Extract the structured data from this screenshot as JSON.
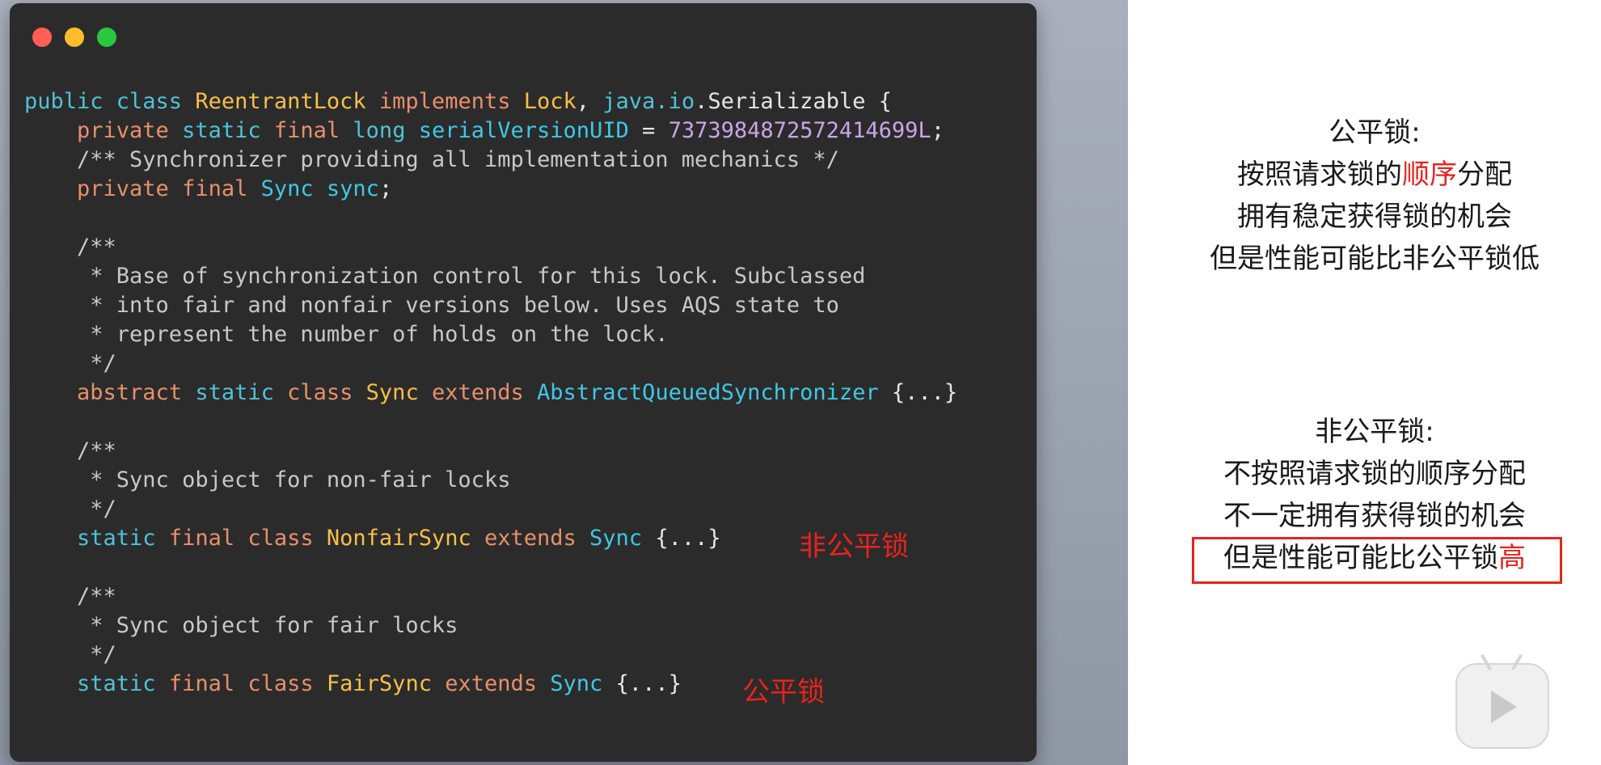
{
  "code": {
    "lines": [
      [
        {
          "t": "public class ",
          "c": "kw2"
        },
        {
          "t": "ReentrantLock",
          "c": "cls"
        },
        {
          "t": " implements ",
          "c": "kw"
        },
        {
          "t": "Lock",
          "c": "cls"
        },
        {
          "t": ", ",
          "c": "punc"
        },
        {
          "t": "java.io",
          "c": "pkg"
        },
        {
          "t": ".Serializable {",
          "c": "punc"
        }
      ],
      [
        {
          "t": "    private ",
          "c": "kw"
        },
        {
          "t": "static ",
          "c": "kw2"
        },
        {
          "t": "final ",
          "c": "kw"
        },
        {
          "t": "long ",
          "c": "kw2"
        },
        {
          "t": "serialVersionUID",
          "c": "type"
        },
        {
          "t": " = ",
          "c": "punc"
        },
        {
          "t": "7373984872572414699L",
          "c": "num"
        },
        {
          "t": ";",
          "c": "punc"
        }
      ],
      [
        {
          "t": "    /** Synchronizer providing all implementation mechanics */",
          "c": "cm"
        }
      ],
      [
        {
          "t": "    private ",
          "c": "kw"
        },
        {
          "t": "final ",
          "c": "kw"
        },
        {
          "t": "Sync ",
          "c": "type"
        },
        {
          "t": "sync",
          "c": "type"
        },
        {
          "t": ";",
          "c": "punc"
        }
      ],
      [
        {
          "t": "",
          "c": "punc"
        }
      ],
      [
        {
          "t": "    /**",
          "c": "cm"
        }
      ],
      [
        {
          "t": "     * Base of synchronization control for this lock. Subclassed",
          "c": "cm"
        }
      ],
      [
        {
          "t": "     * into fair and nonfair versions below. Uses AQS state to",
          "c": "cm"
        }
      ],
      [
        {
          "t": "     * represent the number of holds on the lock.",
          "c": "cm"
        }
      ],
      [
        {
          "t": "     */",
          "c": "cm"
        }
      ],
      [
        {
          "t": "    abstract ",
          "c": "kw"
        },
        {
          "t": "static ",
          "c": "kw2"
        },
        {
          "t": "class ",
          "c": "kw"
        },
        {
          "t": "Sync",
          "c": "cls"
        },
        {
          "t": " extends ",
          "c": "kw"
        },
        {
          "t": "AbstractQueuedSynchronizer",
          "c": "type"
        },
        {
          "t": " {...}",
          "c": "punc"
        }
      ],
      [
        {
          "t": "",
          "c": "punc"
        }
      ],
      [
        {
          "t": "    /**",
          "c": "cm"
        }
      ],
      [
        {
          "t": "     * Sync object for non-fair locks",
          "c": "cm"
        }
      ],
      [
        {
          "t": "     */",
          "c": "cm"
        }
      ],
      [
        {
          "t": "    static ",
          "c": "kw2"
        },
        {
          "t": "final ",
          "c": "kw"
        },
        {
          "t": "class ",
          "c": "kw"
        },
        {
          "t": "NonfairSync",
          "c": "cls"
        },
        {
          "t": " extends ",
          "c": "kw"
        },
        {
          "t": "Sync",
          "c": "type"
        },
        {
          "t": " {...}",
          "c": "punc"
        }
      ],
      [
        {
          "t": "",
          "c": "punc"
        }
      ],
      [
        {
          "t": "    /**",
          "c": "cm"
        }
      ],
      [
        {
          "t": "     * Sync object for fair locks",
          "c": "cm"
        }
      ],
      [
        {
          "t": "     */",
          "c": "cm"
        }
      ],
      [
        {
          "t": "    static ",
          "c": "kw2"
        },
        {
          "t": "final ",
          "c": "kw"
        },
        {
          "t": "class ",
          "c": "kw"
        },
        {
          "t": "FairSync",
          "c": "cls"
        },
        {
          "t": " extends ",
          "c": "kw"
        },
        {
          "t": "Sync",
          "c": "type"
        },
        {
          "t": " {...}",
          "c": "punc"
        }
      ]
    ]
  },
  "annotations": {
    "nonfair": "非公平锁",
    "fair": "公平锁"
  },
  "fair_note": {
    "title": "公平锁:",
    "line1_pre": "按照请求锁的",
    "line1_highlight": "顺序",
    "line1_post": "分配",
    "line2": "拥有稳定获得锁的机会",
    "line3": "但是性能可能比非公平锁低"
  },
  "nonfair_note": {
    "title": "非公平锁:",
    "line1": "不按照请求锁的顺序分配",
    "line2": "不一定拥有获得锁的机会",
    "line3_pre": "但是性能可能比公平锁",
    "line3_highlight": "高"
  },
  "colors": {
    "accent_red": "#e8231e",
    "code_bg": "#2b2b2b"
  },
  "icons": {
    "player": "play-icon"
  }
}
